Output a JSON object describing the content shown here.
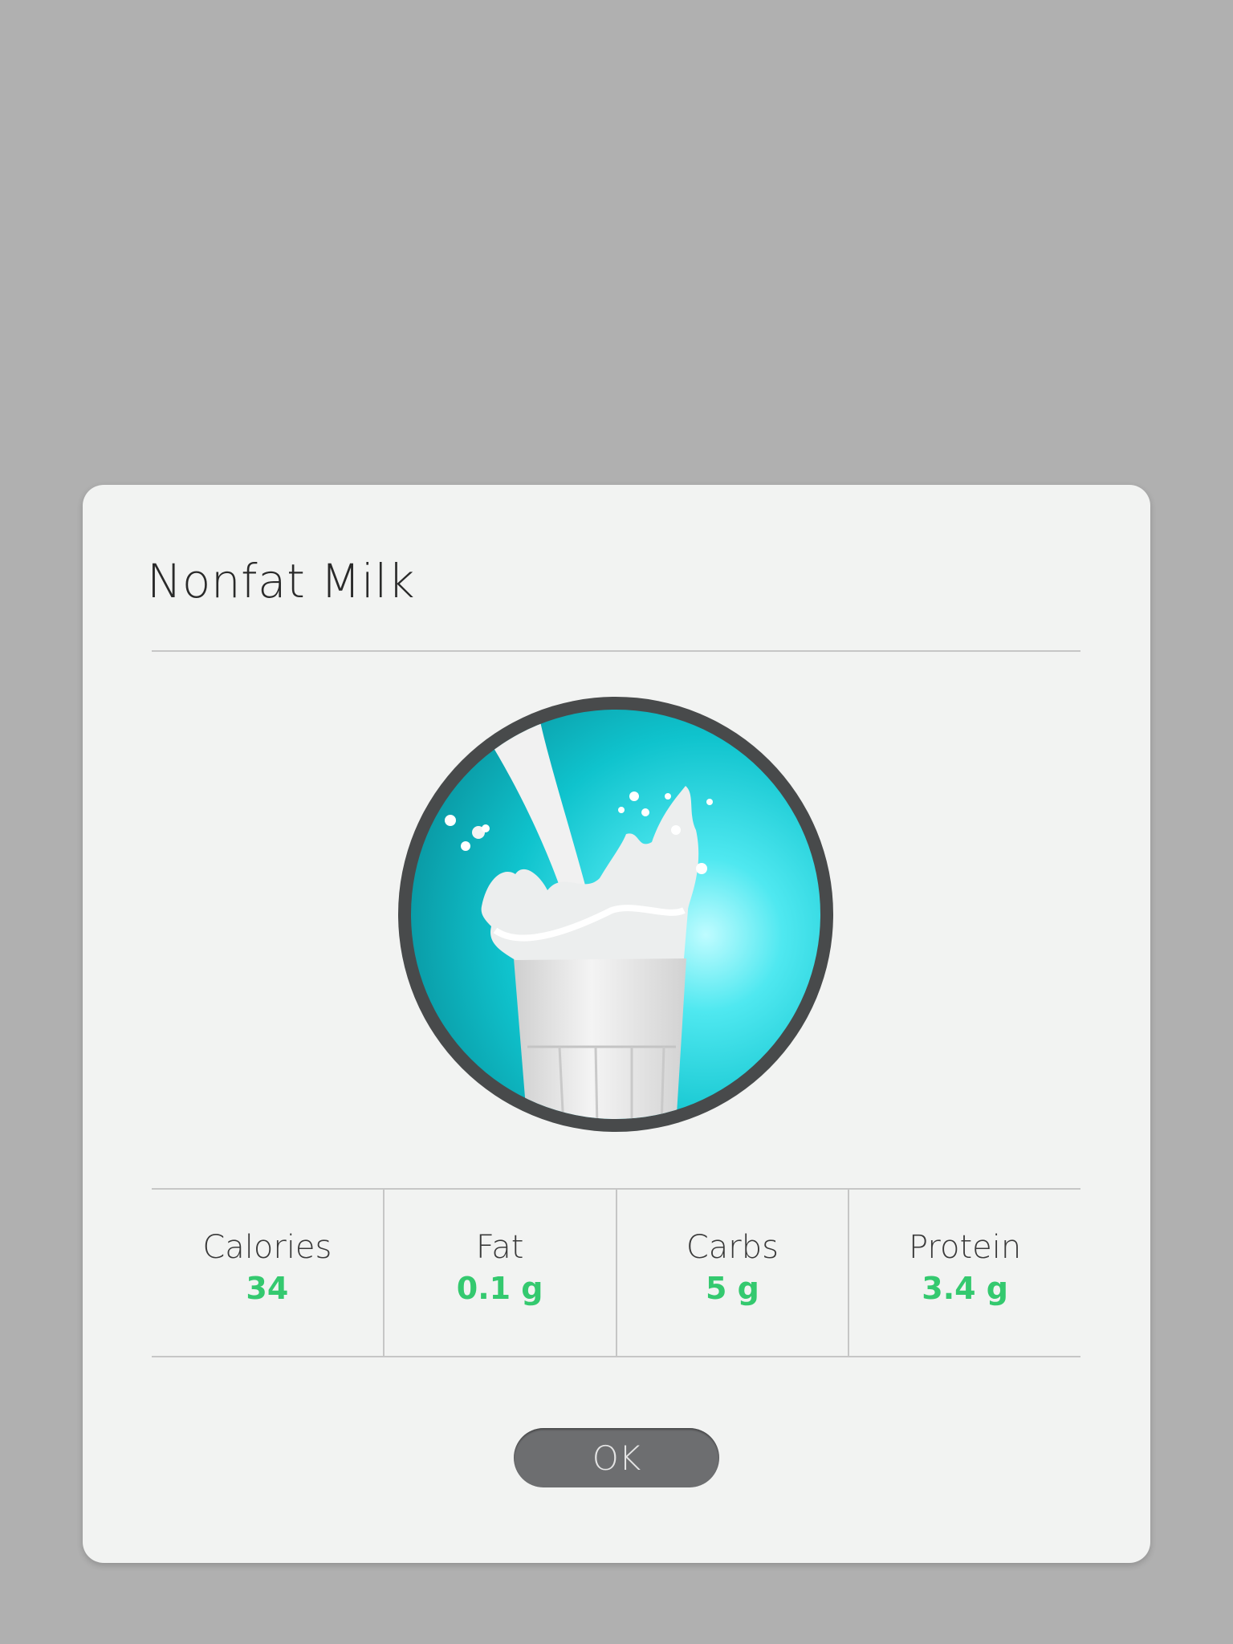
{
  "dialog": {
    "title": "Nonfat Milk",
    "image_icon": "milk-glass-splash-image",
    "stats": [
      {
        "label": "Calories",
        "value": "34"
      },
      {
        "label": "Fat",
        "value": "0.1 g"
      },
      {
        "label": "Carbs",
        "value": "5 g"
      },
      {
        "label": "Protein",
        "value": "3.4 g"
      }
    ],
    "ok_label": "OK"
  },
  "colors": {
    "backdrop": "#b0b0b0",
    "dialog_background": "#f2f3f2",
    "accent_value": "#34c96f",
    "button": "#6d6e70",
    "image_ring": "#484a4b",
    "image_background": "#12c6d0"
  }
}
